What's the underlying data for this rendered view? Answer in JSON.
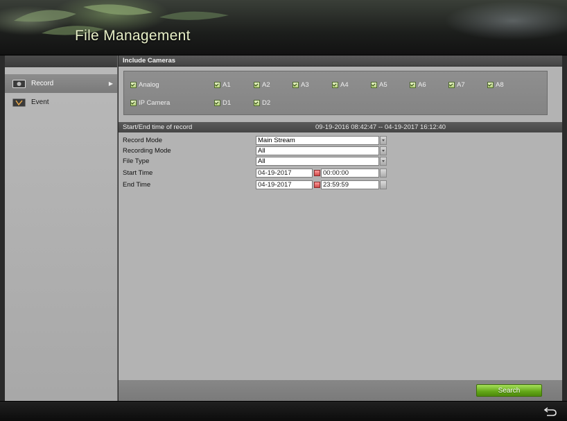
{
  "header": {
    "title": "File Management"
  },
  "sidebar": {
    "items": [
      {
        "label": "Record",
        "icon": "record-camera-icon",
        "active": true
      },
      {
        "label": "Event",
        "icon": "event-icon",
        "active": false
      }
    ]
  },
  "include_cameras": {
    "title": "Include Cameras",
    "analog": {
      "label": "Analog",
      "cameras": [
        "A1",
        "A2",
        "A3",
        "A4",
        "A5",
        "A6",
        "A7",
        "A8"
      ]
    },
    "ip": {
      "label": "IP Camera",
      "cameras": [
        "D1",
        "D2"
      ]
    }
  },
  "record_time": {
    "label": "Start/End time of record",
    "range": "09-19-2016 08:42:47 -- 04-19-2017 16:12:40"
  },
  "fields": {
    "record_mode": {
      "label": "Record Mode",
      "value": "Main Stream"
    },
    "recording_mode": {
      "label": "Recording Mode",
      "value": "All"
    },
    "file_type": {
      "label": "File Type",
      "value": "All"
    },
    "start_time": {
      "label": "Start Time",
      "date": "04-19-2017",
      "time": "00:00:00"
    },
    "end_time": {
      "label": "End Time",
      "date": "04-19-2017",
      "time": "23:59:59"
    }
  },
  "actions": {
    "search_label": "Search"
  },
  "colors": {
    "accent_green": "#62a617",
    "title_text": "#e8f0c8"
  }
}
